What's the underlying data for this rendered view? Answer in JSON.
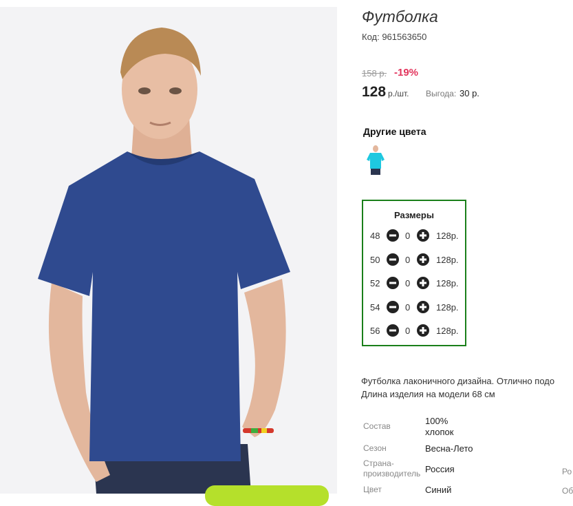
{
  "product": {
    "title": "Футболка",
    "code": "Код: 961563650"
  },
  "pricing": {
    "old_price": "158 р.",
    "discount": "-19%",
    "price": "128",
    "unit": "р./шт.",
    "savings_label": "Выгода:",
    "savings_value": "30 р."
  },
  "other_colors": {
    "title": "Другие цвета",
    "swatches": [
      {
        "color": "#1ec8e0",
        "icon": "tshirt-thumbnail"
      }
    ]
  },
  "sizes": {
    "title": "Размеры",
    "rows": [
      {
        "size": "48",
        "qty": "0",
        "price": "128р."
      },
      {
        "size": "50",
        "qty": "0",
        "price": "128р."
      },
      {
        "size": "52",
        "qty": "0",
        "price": "128р."
      },
      {
        "size": "54",
        "qty": "0",
        "price": "128р."
      },
      {
        "size": "56",
        "qty": "0",
        "price": "128р."
      }
    ]
  },
  "description": {
    "line1": "Футболка лаконичного дизайна. Отлично подо",
    "line2": "Длина изделия на модели 68 см"
  },
  "specs": {
    "composition_label": "Состав",
    "composition_value_1": "100%",
    "composition_value_2": "хлопок",
    "season_label": "Сезон",
    "season_value": "Весна-Лето",
    "country_label_1": "Страна-",
    "country_label_2": "производитель",
    "country_value": "Россия",
    "color_label": "Цвет",
    "color_value": "Синий",
    "cut_right_1": "Ро",
    "cut_right_2": "Об"
  },
  "colors": {
    "frame": "#1a7f1a",
    "discount": "#e2345c",
    "shirt": "#2f4a8f",
    "cart_button": "#b5e02b"
  }
}
